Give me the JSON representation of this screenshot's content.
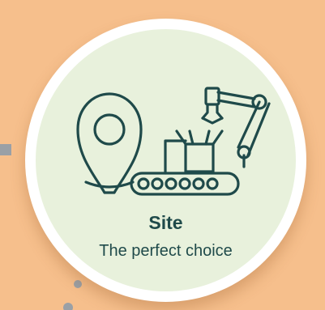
{
  "card": {
    "title": "Site",
    "subtitle": "The perfect choice"
  },
  "icons": [
    "location-pin-icon",
    "conveyor-robot-arm-icon"
  ],
  "colors": {
    "background": "#f6bf8c",
    "card_ring": "#ffffff",
    "card_fill": "#e8f1dc",
    "ink": "#1f4a4a",
    "decor": "#9aa0a6"
  }
}
